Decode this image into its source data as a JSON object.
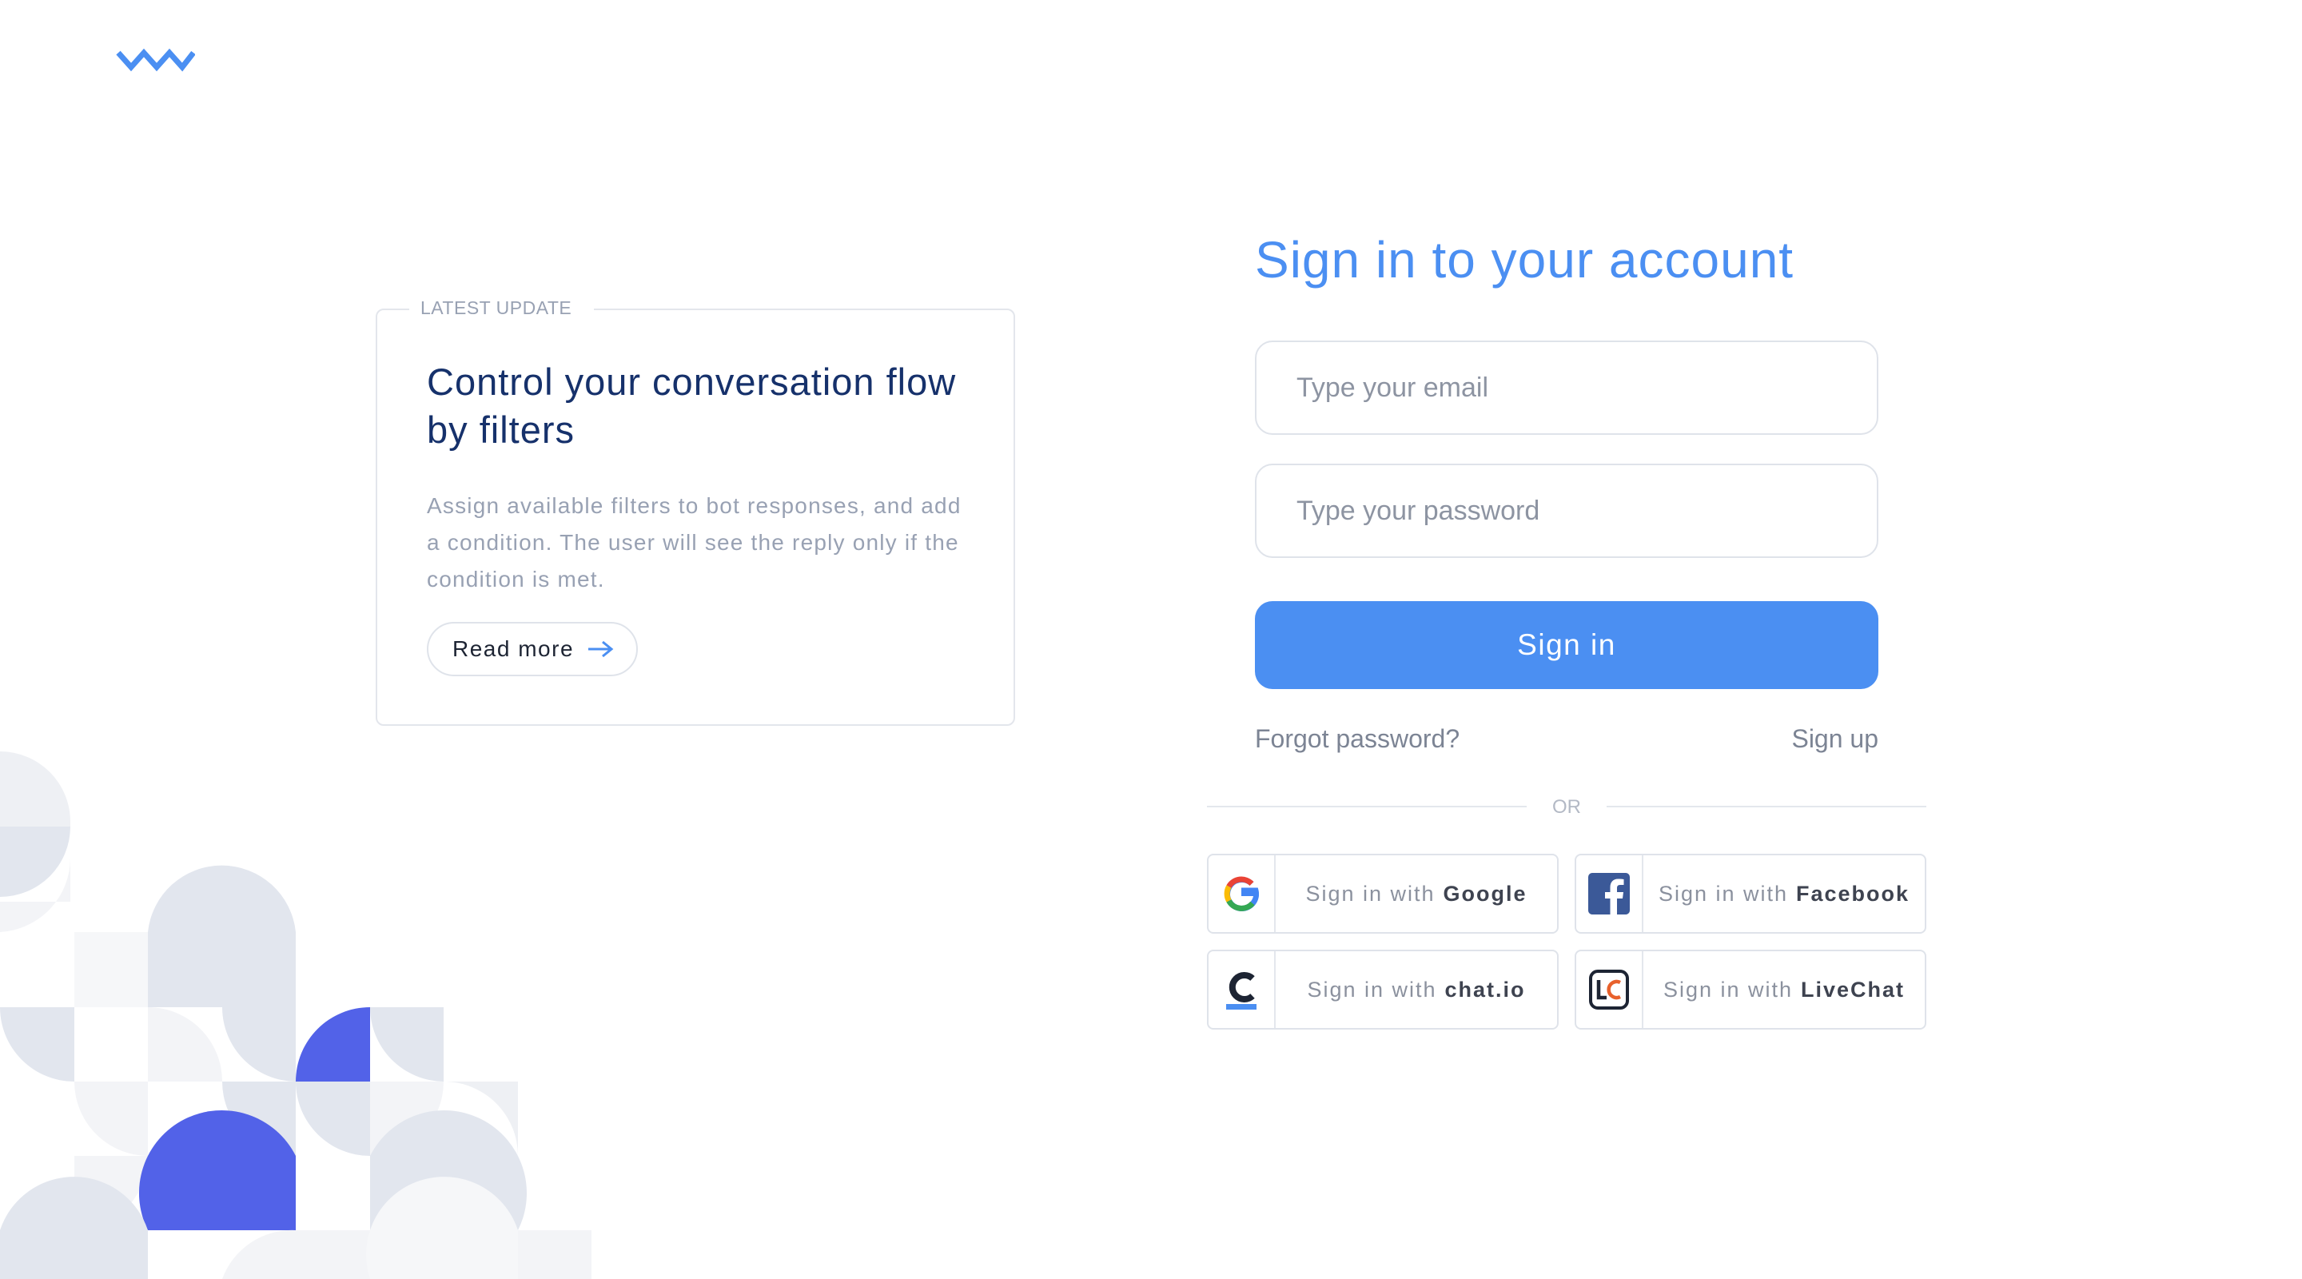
{
  "logo": {
    "icon": "zigzag-logo-icon",
    "color": "#4b8ff2"
  },
  "update_card": {
    "tag": "LATEST UPDATE",
    "title": "Control your conversation flow by filters",
    "body": "Assign available filters to bot responses, and add a condition. The user will see the reply only if the condition is met.",
    "read_more_label": "Read more",
    "read_more_icon": "arrow-right-icon"
  },
  "signin": {
    "title": "Sign in to your account",
    "email_placeholder": "Type your email",
    "password_placeholder": "Type your password",
    "submit_label": "Sign in",
    "forgot_label": "Forgot password?",
    "signup_label": "Sign up",
    "or_label": "OR",
    "accent_color": "#4b8ff2"
  },
  "social": [
    {
      "prefix": "Sign in with",
      "provider": "Google",
      "icon": "google-icon"
    },
    {
      "prefix": "Sign in with",
      "provider": "Facebook",
      "icon": "facebook-icon"
    },
    {
      "prefix": "Sign in with",
      "provider": "chat.io",
      "icon": "chatio-icon"
    },
    {
      "prefix": "Sign in with",
      "provider": "LiveChat",
      "icon": "livechat-icon"
    }
  ],
  "decoration": {
    "pattern_color": "#e2e6ee",
    "pattern_light": "#f2f3f6",
    "pattern_accent": "#5262e8"
  }
}
